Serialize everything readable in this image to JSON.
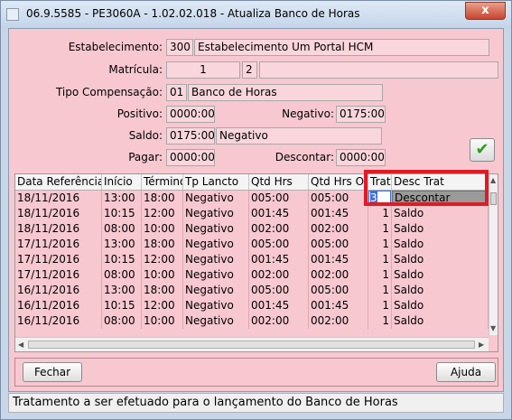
{
  "window": {
    "title": "06.9.5585 - PE3060A - 1.02.02.018 - Atualiza Banco de Horas",
    "close_label": "x"
  },
  "form": {
    "estabelecimento_label": "Estabelecimento:",
    "estabelecimento_code": "300",
    "estabelecimento_name": "Estabelecimento Um Portal HCM",
    "matricula_label": "Matrícula:",
    "matricula_value": "1",
    "matricula_digit": "2",
    "matricula_name": "",
    "tipo_label": "Tipo Compensação:",
    "tipo_code": "01",
    "tipo_name": "Banco de Horas",
    "positivo_label": "Positivo:",
    "positivo_value": "0000:00",
    "negativo_label": "Negativo:",
    "negativo_value": "0175:00",
    "saldo_label": "Saldo:",
    "saldo_value": "0175:00",
    "saldo_desc": "Negativo",
    "pagar_label": "Pagar:",
    "pagar_value": "0000:00",
    "descontar_label": "Descontar:",
    "descontar_value": "0000:00",
    "confirm_icon": "check-icon"
  },
  "grid": {
    "columns": [
      "Data Referência",
      "Início",
      "Término",
      "Tp Lancto",
      "Qtd Hrs",
      "Qtd Hrs Orig",
      "Trat",
      "Desc Trat"
    ],
    "rows": [
      [
        "18/11/2016",
        "13:00",
        "18:00",
        "Negativo",
        "005:00",
        "005:00",
        "3",
        "Descontar"
      ],
      [
        "18/11/2016",
        "10:15",
        "12:00",
        "Negativo",
        "001:45",
        "001:45",
        "1",
        "Saldo"
      ],
      [
        "18/11/2016",
        "08:00",
        "10:00",
        "Negativo",
        "002:00",
        "002:00",
        "1",
        "Saldo"
      ],
      [
        "17/11/2016",
        "13:00",
        "18:00",
        "Negativo",
        "005:00",
        "005:00",
        "1",
        "Saldo"
      ],
      [
        "17/11/2016",
        "10:15",
        "12:00",
        "Negativo",
        "001:45",
        "001:45",
        "1",
        "Saldo"
      ],
      [
        "17/11/2016",
        "08:00",
        "10:00",
        "Negativo",
        "002:00",
        "002:00",
        "1",
        "Saldo"
      ],
      [
        "16/11/2016",
        "13:00",
        "18:00",
        "Negativo",
        "005:00",
        "005:00",
        "1",
        "Saldo"
      ],
      [
        "16/11/2016",
        "10:15",
        "12:00",
        "Negativo",
        "001:45",
        "001:45",
        "1",
        "Saldo"
      ],
      [
        "16/11/2016",
        "08:00",
        "10:00",
        "Negativo",
        "002:00",
        "002:00",
        "1",
        "Saldo"
      ]
    ]
  },
  "buttons": {
    "fechar": "Fechar",
    "ajuda": "Ajuda"
  },
  "status_text": "Tratamento a ser efetuado para o lançamento do Banco de Horas",
  "colors": {
    "panel": "#f7c8d0",
    "highlight": "#e01b24",
    "check": "#2c9c1c"
  }
}
